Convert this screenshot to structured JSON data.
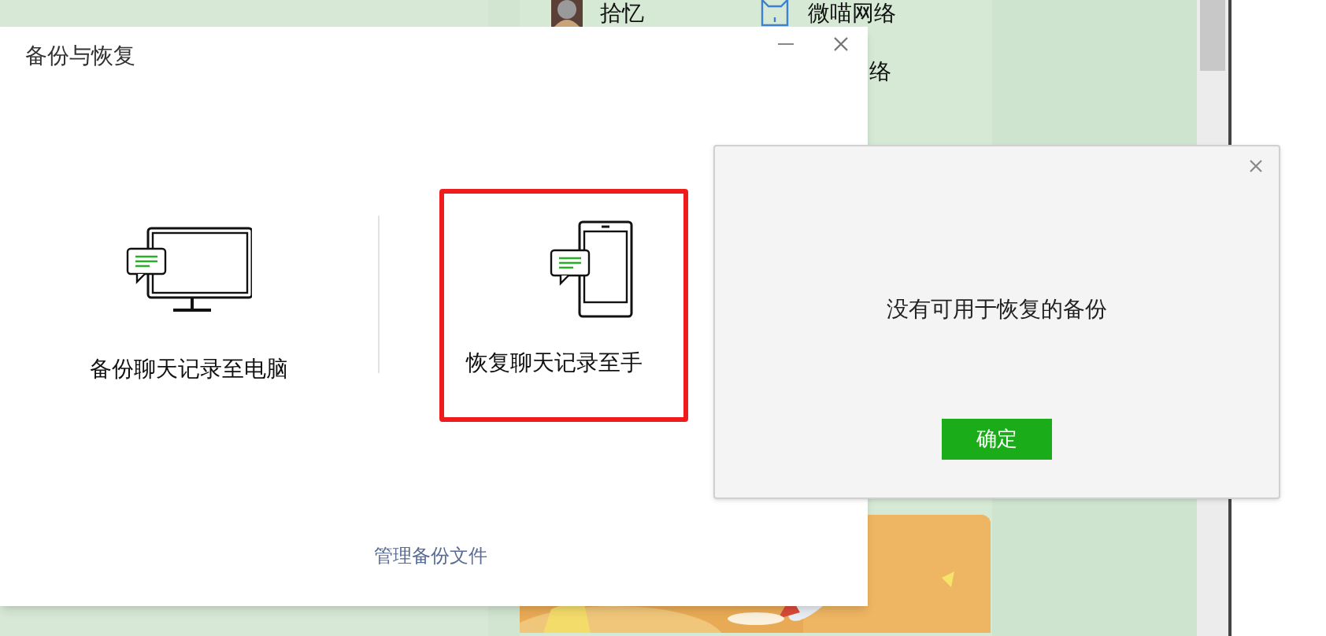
{
  "background": {
    "contacts": [
      {
        "name": "拾忆",
        "kind": "avatar"
      },
      {
        "name": "微喵网络",
        "kind": "brand"
      }
    ],
    "partial_contact": "络"
  },
  "backup_dialog": {
    "title": "备份与恢复",
    "options": [
      {
        "label": "备份聊天记录至电脑",
        "kind": "computer",
        "highlighted": false
      },
      {
        "label": "恢复聊天记录至手",
        "kind": "phone",
        "highlighted": true
      }
    ],
    "manage_link": "管理备份文件"
  },
  "message_box": {
    "message": "没有可用于恢复的备份",
    "button": "确定"
  }
}
